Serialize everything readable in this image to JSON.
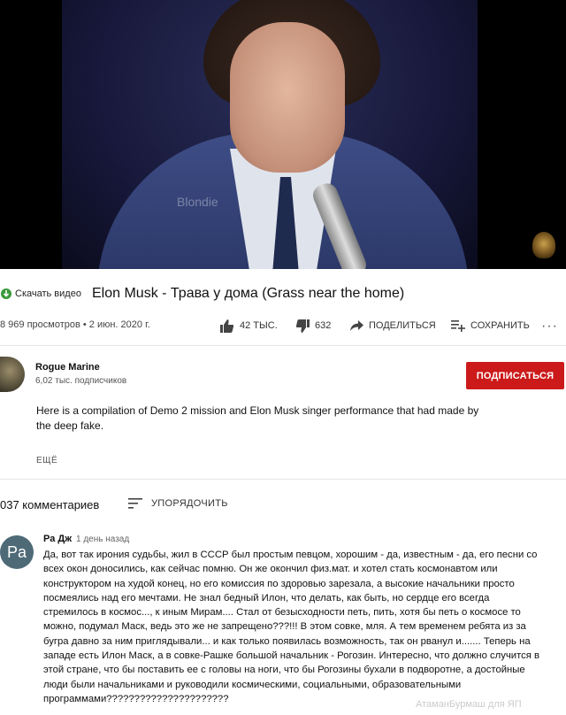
{
  "video": {
    "overlay_text": "Blondie"
  },
  "download_link": {
    "label": "Скачать видео"
  },
  "title": "Elon Musk - Трава у дома (Grass near the home)",
  "stats": {
    "views": "8 969 просмотров • 2 июн. 2020 г.",
    "likes": "42 ТЫС.",
    "dislikes": "632",
    "share_label": "ПОДЕЛИТЬСЯ",
    "save_label": "СОХРАНИТЬ"
  },
  "channel": {
    "name": "Rogue Marine",
    "subscribers": "6,02 тыс. подписчиков",
    "subscribe_label": "ПОДПИСАТЬСЯ"
  },
  "description": {
    "text": "Here is a compilation of Demo 2 mission and Elon Musk singer performance that had made by the deep fake.",
    "more_label": "ЕЩЁ"
  },
  "comments": {
    "count_label": "037 комментариев",
    "sort_label": "УПОРЯДОЧИТЬ",
    "items": [
      {
        "avatar_text": "Pa",
        "author": "Ра Дж",
        "time": "1 день назад",
        "text": "Да, вот так ирония судьбы, жил в СССР был простым певцом, хорошим - да, известным - да, его песни со всех окон доносились, как сейчас помню. Он же окончил физ.мат. и хотел стать космонавтом или конструктором на худой конец, но его комиссия по здоровью зарезала, а высокие начальники просто посмеялись над его мечтами. Не знал  бедный Илон, что делать, как быть, но сердце его всегда стремилось в космос..., к иным Мирам.... Стал от безысходности петь, пить, хотя бы петь о космосе то можно, подумал Маск, ведь это же не запрещено???!!! В этом совке, мля. А тем временем ребята из за бугра давно за ним приглядывали... и как только появилась возможность, так он рванул и....... Теперь на западе есть Илон Маск, а в совке-Рашке большой начальник - Рогозин. Интересно, что должно случится в этой стране, что бы поставить ее с головы на ноги, что бы Рогозины бухали в подворотне, а достойные люди были начальниками и руководили космическими, социальными, образовательными программами??????????????????????"
      }
    ]
  },
  "page_watermark": "АтаманБурмаш для ЯП",
  "colors": {
    "subscribe": "#cc1a1a",
    "avatar": "#4e6a77"
  }
}
